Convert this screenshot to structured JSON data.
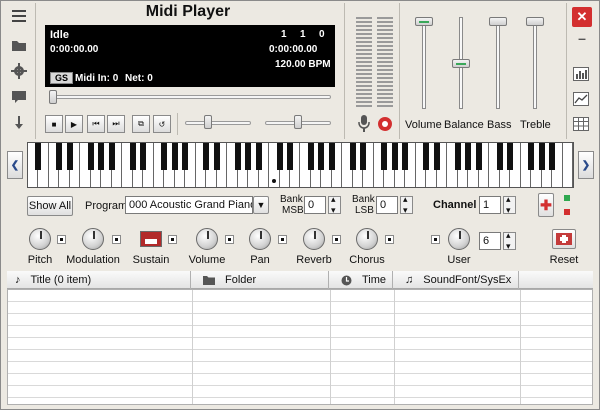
{
  "app": {
    "title": "Midi Player"
  },
  "left_toolbar": {
    "icons": [
      "menu-icon",
      "folder-icon",
      "gear-icon",
      "chat-icon",
      "down-arrow-icon"
    ]
  },
  "lcd": {
    "status": "Idle",
    "counters": [
      "1",
      "1",
      "0"
    ],
    "time_left": "0:00:00.00",
    "time_right": "0:00:00.00",
    "bpm": "120.00 BPM",
    "mode_badge": "GS",
    "midi_in": "Midi In: 0",
    "net": "Net: 0"
  },
  "transport": {
    "icons": [
      "stop-icon",
      "play-icon",
      "prev-icon",
      "next-icon",
      "repeat-icon",
      "undo-icon"
    ]
  },
  "eq": {
    "labels": [
      "Volume",
      "Balance",
      "Bass",
      "Treble"
    ]
  },
  "window_buttons": {
    "close": "✕",
    "minimize": "–"
  },
  "right_toolbar": {
    "icons": [
      "bars-icon",
      "line-chart-icon",
      "grid-icon"
    ]
  },
  "controls": {
    "show_all": "Show All",
    "program_label": "Program",
    "program_value": "000 Acoustic Grand Piano",
    "bank_msb_label_1": "Bank",
    "bank_msb_label_2": "MSB",
    "bank_msb_value": "0",
    "bank_lsb_label_1": "Bank",
    "bank_lsb_label_2": "LSB",
    "bank_lsb_value": "0",
    "channel_label": "Channel",
    "channel_value": "1"
  },
  "knobs": {
    "labels": [
      "Pitch",
      "Modulation",
      "Sustain",
      "Volume",
      "Pan",
      "Reverb",
      "Chorus",
      "User"
    ],
    "user_value": "6",
    "reset": "Reset"
  },
  "playlist": {
    "columns": [
      "Title (0 item)",
      "Folder",
      "Time",
      "SoundFont/SysEx"
    ],
    "rows": []
  },
  "colors": {
    "accent_red": "#d32f2f",
    "accent_green": "#2fa84f",
    "lcd_bg": "#000000"
  }
}
